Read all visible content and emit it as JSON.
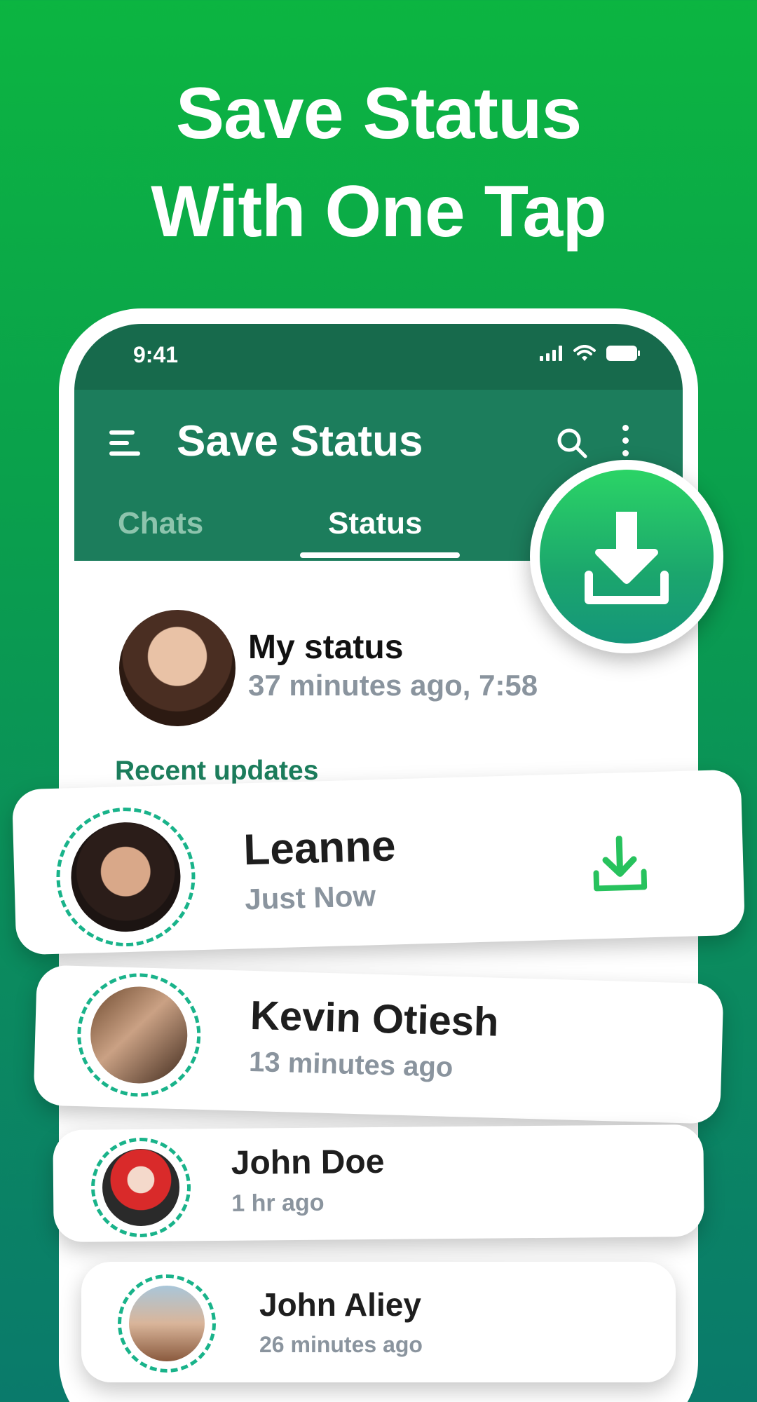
{
  "headline": {
    "line1": "Save Status",
    "line2": "With One Tap"
  },
  "status_bar": {
    "time": "9:41",
    "icons": [
      "signal-icon",
      "wifi-icon",
      "battery-icon"
    ]
  },
  "app_bar": {
    "title": "Save Status",
    "tabs": [
      {
        "label": "Chats",
        "selected": false
      },
      {
        "label": "Status",
        "selected": true
      }
    ]
  },
  "my_status": {
    "name": "My status",
    "time": "37 minutes ago, 7:58"
  },
  "recent": {
    "label": "Recent updates",
    "items": [
      {
        "name": "Leanne",
        "time": "Just Now"
      },
      {
        "name": "Kevin Otiesh",
        "time": "13 minutes ago"
      },
      {
        "name": "John Doe",
        "time": "1 hr ago"
      },
      {
        "name": "John Aliey",
        "time": "26 minutes ago"
      }
    ]
  },
  "colors": {
    "brand_green": "#1c7d5c",
    "accent": "#19b38a",
    "download_green": "#2bd466"
  }
}
